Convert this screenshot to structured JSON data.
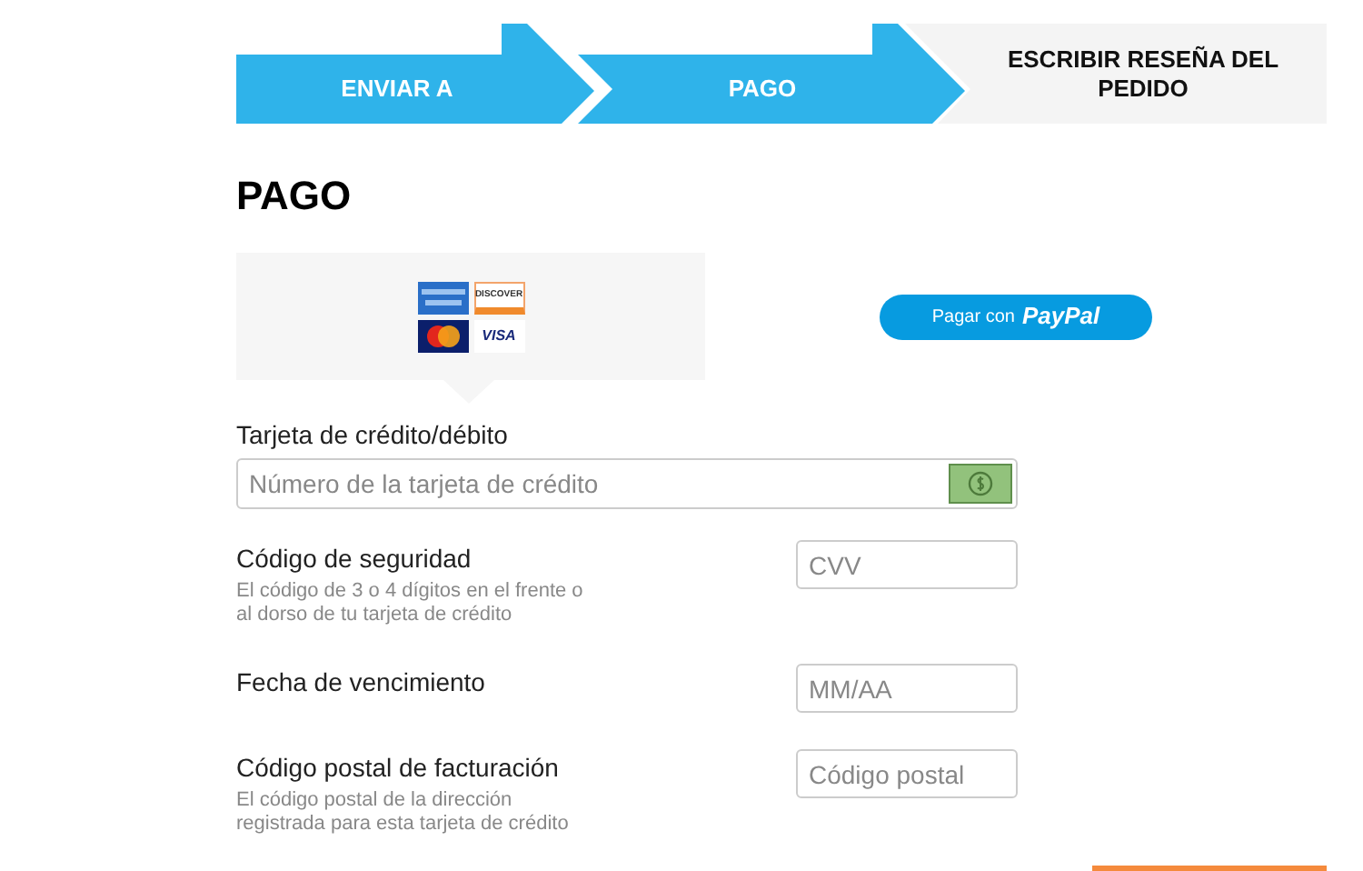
{
  "steps": [
    {
      "label": "ENVIAR A",
      "reached": true
    },
    {
      "label": "PAGO",
      "reached": true
    },
    {
      "label": "ESCRIBIR RESEÑA DEL PEDIDO",
      "reached": false
    }
  ],
  "heading": "PAGO",
  "payment_options": {
    "cards": [
      {
        "kind": "amex"
      },
      {
        "kind": "discover",
        "label": "DISCOVER"
      },
      {
        "kind": "mastercard"
      },
      {
        "kind": "visa",
        "label": "VISA"
      }
    ],
    "paypal_button": {
      "label": "Pagar con",
      "brand": "PayPal"
    }
  },
  "card_number": {
    "label": "Tarjeta de crédito/débito",
    "placeholder": "Número de la tarjeta de crédito"
  },
  "fields": [
    {
      "label": "Código de seguridad",
      "help": "El código de 3 o 4 dígitos en el frente o al dorso de tu tarjeta de crédito",
      "placeholder": "CVV"
    },
    {
      "label": "Fecha de vencimiento",
      "placeholder": "MM/AA"
    },
    {
      "label": "Código postal de facturación",
      "help": "El código postal de la dirección registrada para esta tarjeta de crédito",
      "placeholder": "Código postal"
    }
  ]
}
